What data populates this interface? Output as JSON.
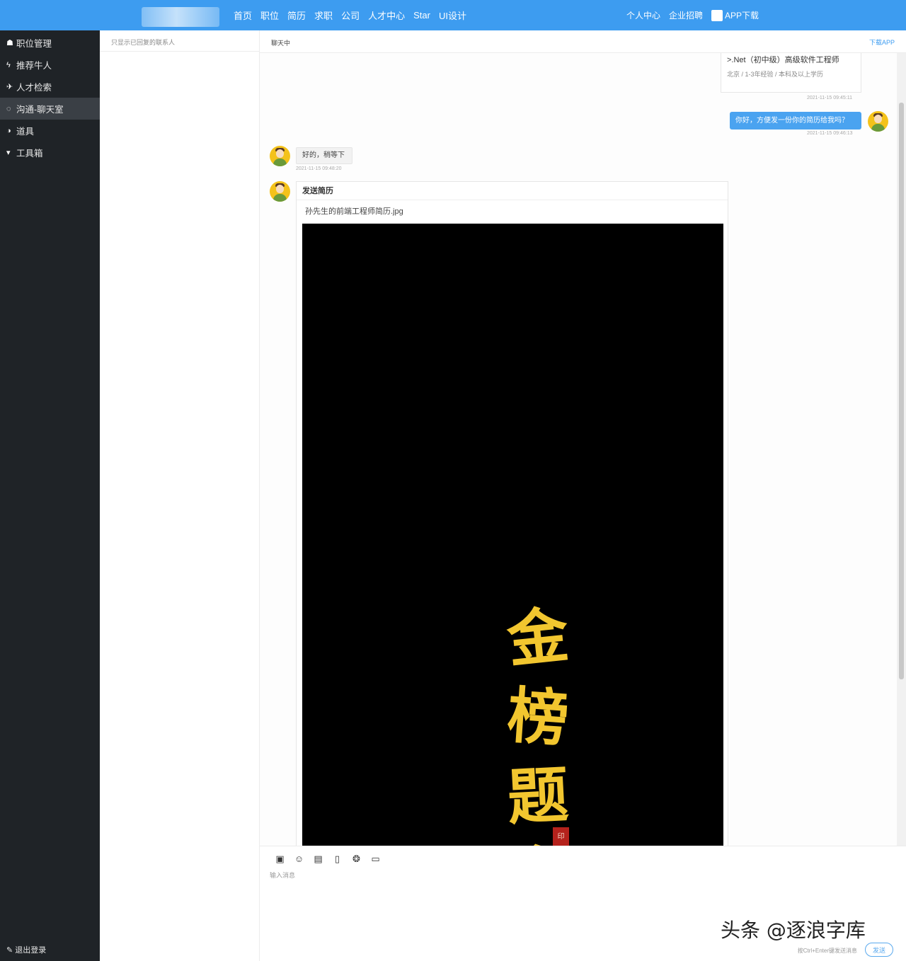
{
  "header": {
    "nav": [
      "首页",
      "职位",
      "简历",
      "求职",
      "公司",
      "人才中心",
      "Star",
      "UI设计"
    ],
    "right_links": [
      "个人中心",
      "企业招聘"
    ],
    "app_download": "APP下载"
  },
  "sidebar": {
    "items": [
      {
        "icon": "home-icon",
        "label": "职位管理"
      },
      {
        "icon": "lightning-icon",
        "label": "推荐牛人"
      },
      {
        "icon": "send-icon",
        "label": "人才检索"
      },
      {
        "icon": "chat-icon",
        "label": "沟通-聊天室"
      },
      {
        "icon": "pie-icon",
        "label": "道具"
      },
      {
        "icon": "cart-icon",
        "label": "工具箱"
      }
    ],
    "bottom": "退出登录"
  },
  "contacts": {
    "header": "只显示已回复的联系人"
  },
  "chat": {
    "title": "聊天中",
    "download": "下载APP",
    "job_card": {
      "title": ">.Net（初中级）高级软件工程师",
      "meta": "北京 / 1-3年经验 / 本科及以上学历"
    },
    "ts1": "2021-11-15 09:45:11",
    "outgoing": "你好，方便发一份你的简历给我吗？",
    "ts2": "2021-11-15 09:46:13",
    "incoming": "好的，稍等下",
    "ts3": "2021-11-15 09:48:20",
    "resume": {
      "title": "发送简历",
      "file": "孙先生的前端工程师简历.jpg",
      "image_text": [
        "金",
        "榜",
        "题",
        "名"
      ],
      "seal": "印"
    }
  },
  "input": {
    "tools": [
      "message-icon",
      "emoji-icon",
      "photo-icon",
      "phone-icon",
      "wechat-icon",
      "image-icon"
    ],
    "placeholder": "输入消息",
    "hint": "按Ctrl+Enter键发送消息",
    "send": "发送"
  },
  "watermark": "头条 @逐浪字库",
  "colors": {
    "topbar": "#3d9cf0",
    "sidebar": "#1f2327",
    "accent": "#4aa3f0",
    "calligraphy": "#f2c62f"
  }
}
